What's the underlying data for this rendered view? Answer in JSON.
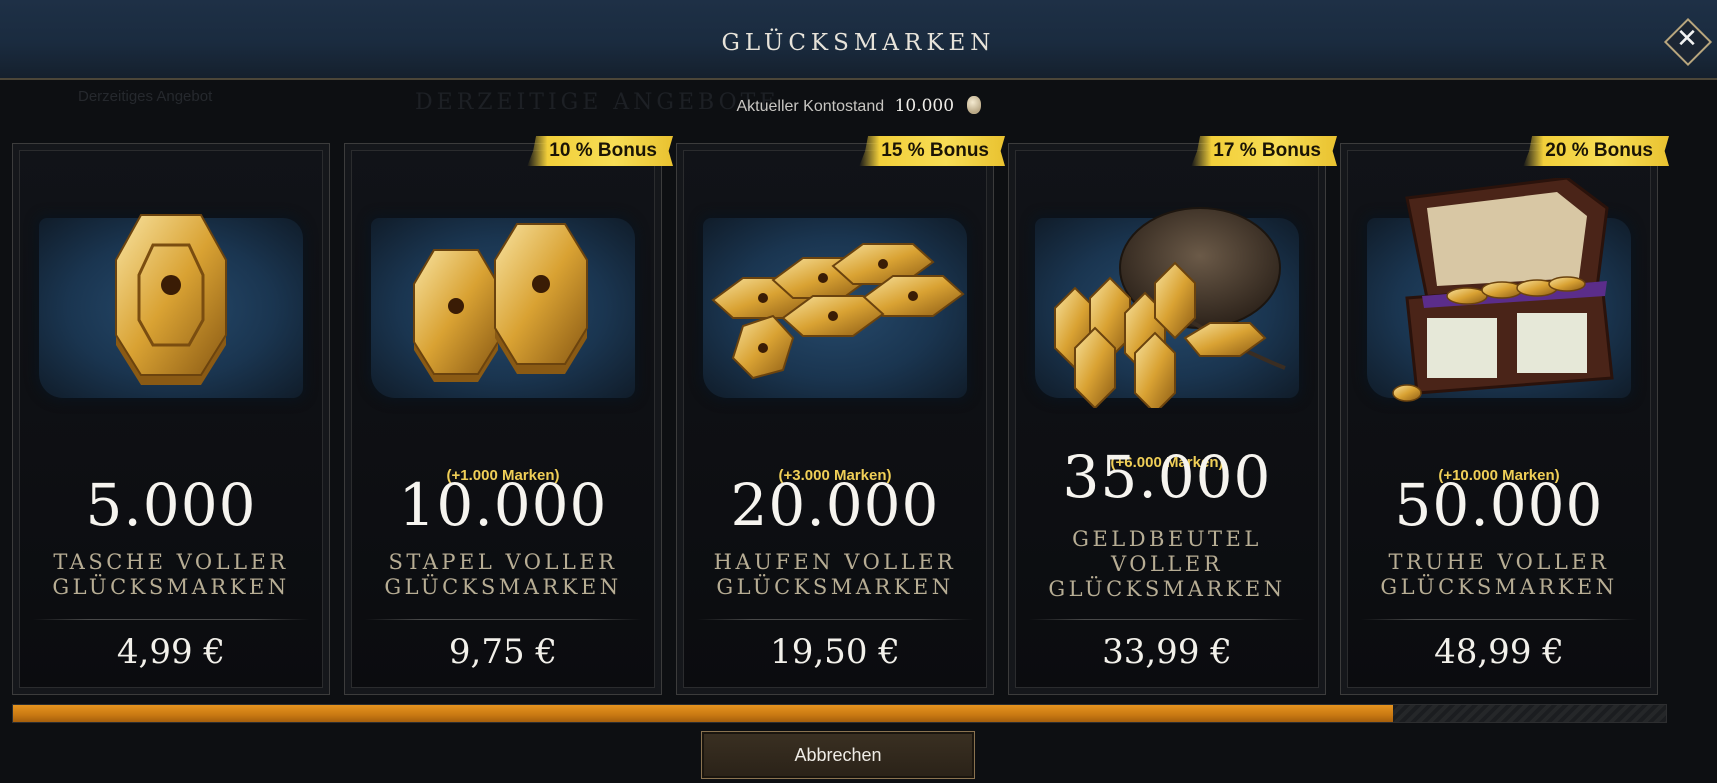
{
  "background": {
    "ghost_left": "Derzeitiges Angebot",
    "ghost_center": "DERZEITIGE ANGEBOTE"
  },
  "header": {
    "title": "GLÜCKSMARKEN",
    "close_icon": "close-icon"
  },
  "balance": {
    "label": "Aktueller Kontostand",
    "value": "10.000",
    "icon": "luck-token-icon"
  },
  "offers": [
    {
      "bonus": "",
      "extra": "",
      "amount": "5.000",
      "name": "TASCHE VOLLER GLÜCKSMARKEN",
      "price": "4,99 €",
      "art": "single-token-stack"
    },
    {
      "bonus": "10 % Bonus",
      "extra": "(+1.000 Marken)",
      "amount": "10.000",
      "name": "STAPEL VOLLER GLÜCKSMARKEN",
      "price": "9,75 €",
      "art": "two-token-stacks"
    },
    {
      "bonus": "15 % Bonus",
      "extra": "(+3.000 Marken)",
      "amount": "20.000",
      "name": "HAUFEN VOLLER GLÜCKSMARKEN",
      "price": "19,50 €",
      "art": "token-pile"
    },
    {
      "bonus": "17 % Bonus",
      "extra": "(+6.000 Marken)",
      "amount": "35.000",
      "name": "GELDBEUTEL VOLLER GLÜCKSMARKEN",
      "price": "33,99 €",
      "art": "token-pouch"
    },
    {
      "bonus": "20 % Bonus",
      "extra": "(+10.000 Marken)",
      "amount": "50.000",
      "name": "TRUHE VOLLER GLÜCKSMARKEN",
      "price": "48,99 €",
      "art": "token-chest"
    }
  ],
  "scroll_progress": 0.835,
  "footer": {
    "cancel_label": "Abbrechen"
  },
  "colors": {
    "bonus_banner": "#f2cf3a",
    "extra_text": "#f0cf57",
    "progress_fill": "#e6941f",
    "header_bg": "#1e3046"
  }
}
